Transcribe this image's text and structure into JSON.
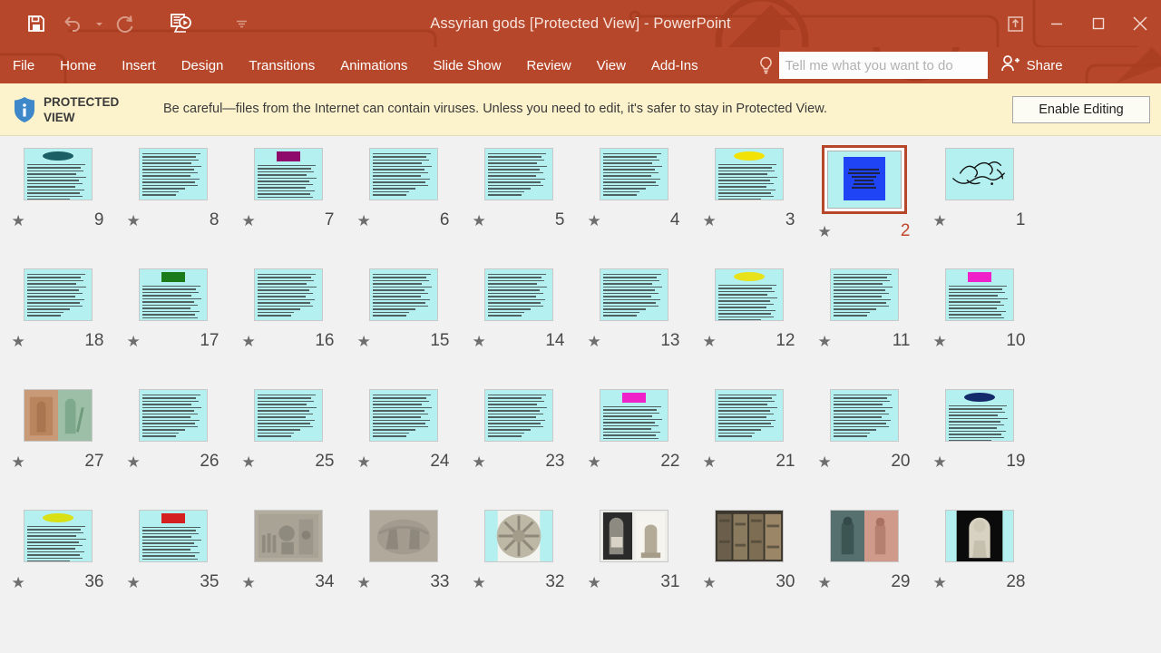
{
  "window": {
    "title": "Assyrian gods [Protected View] - PowerPoint",
    "accent_color": "#b7472a",
    "quick_access": [
      {
        "name": "save-icon",
        "label": "Save",
        "dim": false
      },
      {
        "name": "undo-icon",
        "label": "Undo",
        "dim": true
      },
      {
        "name": "undo-dropdown-icon",
        "label": "Undo options",
        "dim": true
      },
      {
        "name": "redo-icon",
        "label": "Redo",
        "dim": true
      },
      {
        "name": "start-from-beginning-icon",
        "label": "Start From Beginning",
        "dim": false
      },
      {
        "name": "customize-quick-access-toolbar-icon",
        "label": "Customize Quick Access Toolbar",
        "dim": true
      }
    ],
    "controls": [
      {
        "name": "ribbon-display-options-icon",
        "label": "Ribbon Display Options"
      },
      {
        "name": "minimize-icon",
        "label": "Minimize"
      },
      {
        "name": "restore-icon",
        "label": "Restore Down"
      },
      {
        "name": "close-icon",
        "label": "Close"
      }
    ]
  },
  "menu": {
    "items": [
      {
        "name": "file",
        "label": "File"
      },
      {
        "name": "home",
        "label": "Home"
      },
      {
        "name": "insert",
        "label": "Insert"
      },
      {
        "name": "design",
        "label": "Design"
      },
      {
        "name": "transitions",
        "label": "Transitions"
      },
      {
        "name": "animations",
        "label": "Animations"
      },
      {
        "name": "slide-show",
        "label": "Slide Show"
      },
      {
        "name": "review",
        "label": "Review"
      },
      {
        "name": "view",
        "label": "View"
      },
      {
        "name": "add-ins",
        "label": "Add-Ins"
      }
    ],
    "tell_me_placeholder": "Tell me what you want to do",
    "share_label": "Share"
  },
  "protected_view": {
    "title_line1": "PROTECTED",
    "title_line2": "VIEW",
    "message": "Be careful—files from the Internet can contain viruses. Unless you need to edit, it's safer to stay in Protected View.",
    "enable_button": "Enable Editing",
    "bar_color": "#fcf3cc"
  },
  "slide_sorter": {
    "selected_slide": 2,
    "star_glyph": "★",
    "rows": [
      [
        {
          "number": "9",
          "type": "text",
          "shape": "ellipse",
          "shape_color": "#1b5e63",
          "lines": 13,
          "selected": false
        },
        {
          "number": "8",
          "type": "text",
          "shape": "none",
          "shape_color": "",
          "lines": 14,
          "selected": false
        },
        {
          "number": "7",
          "type": "text",
          "shape": "rect",
          "shape_color": "#8e0a6b",
          "lines": 11,
          "selected": false
        },
        {
          "number": "6",
          "type": "text",
          "shape": "none",
          "shape_color": "",
          "lines": 14,
          "selected": false
        },
        {
          "number": "5",
          "type": "text",
          "shape": "none",
          "shape_color": "",
          "lines": 14,
          "selected": false
        },
        {
          "number": "4",
          "type": "text",
          "shape": "none",
          "shape_color": "",
          "lines": 14,
          "selected": false
        },
        {
          "number": "3",
          "type": "text",
          "shape": "ellipse",
          "shape_color": "#f2e205",
          "lines": 12,
          "selected": false
        },
        {
          "number": "2",
          "type": "title-blue",
          "shape": "none",
          "shape_color": "#1f44f5",
          "lines": 6,
          "selected": true
        },
        {
          "number": "1",
          "type": "calligraphy",
          "shape": "none",
          "shape_color": "",
          "lines": 0,
          "selected": false
        }
      ],
      [
        {
          "number": "18",
          "type": "text",
          "shape": "none",
          "shape_color": "",
          "lines": 14,
          "selected": false
        },
        {
          "number": "17",
          "type": "text",
          "shape": "rect",
          "shape_color": "#1b7a19",
          "lines": 12,
          "selected": false
        },
        {
          "number": "16",
          "type": "text",
          "shape": "none",
          "shape_color": "",
          "lines": 14,
          "selected": false
        },
        {
          "number": "15",
          "type": "text",
          "shape": "none",
          "shape_color": "",
          "lines": 14,
          "selected": false
        },
        {
          "number": "14",
          "type": "text",
          "shape": "none",
          "shape_color": "",
          "lines": 14,
          "selected": false
        },
        {
          "number": "13",
          "type": "text",
          "shape": "none",
          "shape_color": "",
          "lines": 14,
          "selected": false
        },
        {
          "number": "12",
          "type": "text",
          "shape": "ellipse",
          "shape_color": "#e8e21a",
          "lines": 12,
          "selected": false
        },
        {
          "number": "11",
          "type": "text",
          "shape": "none",
          "shape_color": "",
          "lines": 14,
          "selected": false
        },
        {
          "number": "10",
          "type": "text",
          "shape": "rect",
          "shape_color": "#ee22c8",
          "lines": 12,
          "selected": false
        }
      ],
      [
        {
          "number": "27",
          "type": "image-duo",
          "shape": "none",
          "shape_color": "",
          "lines": 0,
          "selected": false,
          "image_name": "assyrian-relief-pair-thumbnail"
        },
        {
          "number": "26",
          "type": "text",
          "shape": "none",
          "shape_color": "",
          "lines": 14,
          "selected": false
        },
        {
          "number": "25",
          "type": "text",
          "shape": "none",
          "shape_color": "",
          "lines": 14,
          "selected": false
        },
        {
          "number": "24",
          "type": "text",
          "shape": "none",
          "shape_color": "",
          "lines": 14,
          "selected": false
        },
        {
          "number": "23",
          "type": "text",
          "shape": "none",
          "shape_color": "",
          "lines": 14,
          "selected": false
        },
        {
          "number": "22",
          "type": "text",
          "shape": "rect",
          "shape_color": "#ee22c8",
          "lines": 12,
          "selected": false
        },
        {
          "number": "21",
          "type": "text",
          "shape": "none",
          "shape_color": "",
          "lines": 14,
          "selected": false
        },
        {
          "number": "20",
          "type": "text",
          "shape": "none",
          "shape_color": "",
          "lines": 14,
          "selected": false
        },
        {
          "number": "19",
          "type": "text",
          "shape": "ellipse",
          "shape_color": "#132a6b",
          "lines": 12,
          "selected": false
        }
      ],
      [
        {
          "number": "36",
          "type": "text",
          "shape": "ellipse",
          "shape_color": "#d9e016",
          "lines": 12,
          "selected": false
        },
        {
          "number": "35",
          "type": "text",
          "shape": "rect",
          "shape_color": "#d42020",
          "lines": 12,
          "selected": false
        },
        {
          "number": "34",
          "type": "image-relief",
          "shape": "none",
          "shape_color": "",
          "lines": 0,
          "selected": false,
          "image_name": "assyrian-temple-relief-thumbnail"
        },
        {
          "number": "33",
          "type": "image-relief2",
          "shape": "none",
          "shape_color": "",
          "lines": 0,
          "selected": false,
          "image_name": "assyrian-winged-relief-thumbnail"
        },
        {
          "number": "32",
          "type": "image-disc",
          "shape": "none",
          "shape_color": "",
          "lines": 0,
          "selected": false,
          "image_name": "shamash-sun-disc-thumbnail"
        },
        {
          "number": "31",
          "type": "image-stele",
          "shape": "none",
          "shape_color": "",
          "lines": 0,
          "selected": false,
          "image_name": "stele-and-statue-thumbnail"
        },
        {
          "number": "30",
          "type": "image-columns",
          "shape": "none",
          "shape_color": "",
          "lines": 0,
          "selected": false,
          "image_name": "carved-columns-thumbnail"
        },
        {
          "number": "29",
          "type": "image-figures",
          "shape": "none",
          "shape_color": "",
          "lines": 0,
          "selected": false,
          "image_name": "two-deity-figures-thumbnail"
        },
        {
          "number": "28",
          "type": "image-statue",
          "shape": "none",
          "shape_color": "",
          "lines": 0,
          "selected": false,
          "image_name": "seated-statue-thumbnail"
        }
      ]
    ]
  }
}
